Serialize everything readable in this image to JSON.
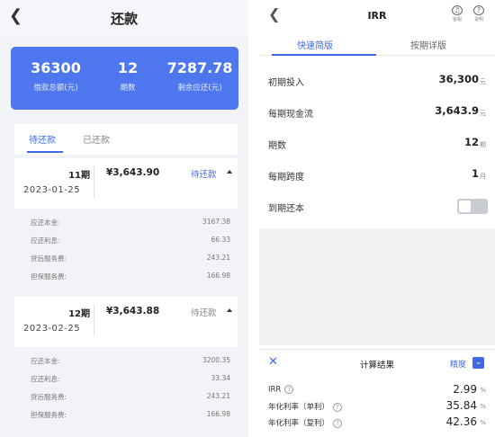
{
  "left": {
    "back_icon": "chevron-left-icon",
    "title": "还款",
    "summary": {
      "total_amount": "36300",
      "total_amount_label": "借款总额(元)",
      "periods": "12",
      "periods_label": "期数",
      "remaining": "7287.78",
      "remaining_label": "剩余应还(元)",
      "bg_color": "#4e76ee"
    },
    "tabs": [
      "待还款",
      "已还款"
    ],
    "installments": [
      {
        "period": "11期",
        "date": "2023-01-25",
        "amount": "¥3,643.90",
        "status": "待还款",
        "details": [
          {
            "label": "应还本金:",
            "value": "3167.38"
          },
          {
            "label": "应还利息:",
            "value": "66.33"
          },
          {
            "label": "贷后服务费:",
            "value": "243.21"
          },
          {
            "label": "担保服务费:",
            "value": "166.98"
          }
        ]
      },
      {
        "period": "12期",
        "date": "2023-02-25",
        "amount": "¥3,643.88",
        "status": "待还款",
        "details": [
          {
            "label": "应还本金:",
            "value": "3200.35"
          },
          {
            "label": "应还利息:",
            "value": "33.34"
          },
          {
            "label": "贷后服务费:",
            "value": "243.21"
          },
          {
            "label": "担保服务费:",
            "value": "166.98"
          }
        ]
      }
    ]
  },
  "right": {
    "back_icon": "chevron-left-icon",
    "title": "IRR",
    "header_icons": [
      {
        "icon": "headset-icon",
        "label": "客服"
      },
      {
        "icon": "help-icon",
        "label": "说明"
      }
    ],
    "tabs": [
      "快速简版",
      "按期详版"
    ],
    "fields": [
      {
        "label": "初期投入",
        "value": "36,300",
        "unit": "元"
      },
      {
        "label": "每期现金流",
        "value": "3,643.9",
        "unit": "元"
      },
      {
        "label": "期数",
        "value": "12",
        "unit": "期"
      },
      {
        "label": "每期跨度",
        "value": "1",
        "unit": "月"
      }
    ],
    "toggle_label": "到期还本",
    "toggle_on": false,
    "result": {
      "title": "计算结果",
      "precision_label": "精度",
      "rows": [
        {
          "label": "IRR",
          "value": "2.99",
          "unit": "%"
        },
        {
          "label": "年化利率（单利）",
          "value": "35.84",
          "unit": "%"
        },
        {
          "label": "年化利率（复利）",
          "value": "42.36",
          "unit": "%"
        }
      ]
    },
    "accent_color": "#3f6ae6"
  }
}
